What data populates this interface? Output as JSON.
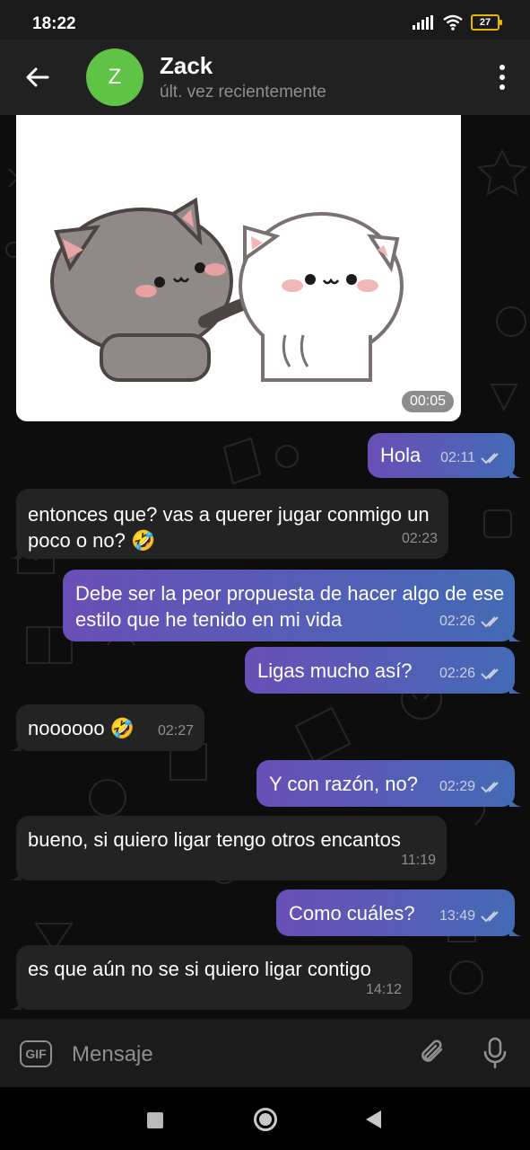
{
  "status_bar": {
    "time": "18:22",
    "battery": "27"
  },
  "header": {
    "avatar_letter": "Z",
    "name": "Zack",
    "status": "últ. vez recientemente"
  },
  "sticker": {
    "duration": "00:05"
  },
  "messages": [
    {
      "direction": "out",
      "text": "Hola",
      "time": "02:11"
    },
    {
      "direction": "in",
      "text": "entonces que? vas a querer jugar conmigo un poco o no? 🤣",
      "time": "02:23"
    },
    {
      "direction": "out",
      "text": "Debe ser la peor propuesta de hacer algo de ese estilo que he tenido en mi vida",
      "time": "02:26"
    },
    {
      "direction": "out",
      "text": "Ligas mucho así?",
      "time": "02:26"
    },
    {
      "direction": "in",
      "text": "noooooo 🤣",
      "time": "02:27"
    },
    {
      "direction": "out",
      "text": "Y con razón, no?",
      "time": "02:29"
    },
    {
      "direction": "in",
      "text": "bueno, si quiero ligar tengo otros encantos",
      "time": "11:19"
    },
    {
      "direction": "out",
      "text": "Como cuáles?",
      "time": "13:49"
    },
    {
      "direction": "in",
      "text": "es que aún no se si quiero ligar contigo",
      "time": "14:12"
    }
  ],
  "composer": {
    "gif_label": "GIF",
    "placeholder": "Mensaje"
  },
  "colors": {
    "avatar": "#5fc346",
    "incoming_bubble": "#232323",
    "outgoing_start": "#6a4fb7",
    "outgoing_end": "#436ab5"
  }
}
